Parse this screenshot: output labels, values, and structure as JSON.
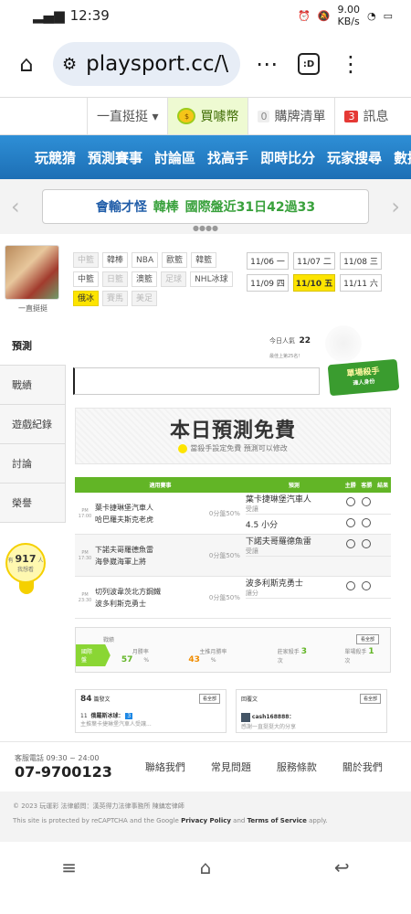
{
  "status": {
    "time": "12:39",
    "speed": "9.00",
    "speed_unit": "KB/s",
    "battery_icon": "battery-icon"
  },
  "browser": {
    "url": "playsport.cc/\\",
    "tab_icon": ":D"
  },
  "topnav": {
    "dropdown": "一直挺挺 ▾",
    "coins": "買噱幣",
    "list_count": "0",
    "list_label": "購牌清單",
    "msg_count": "3",
    "msg_label": "訊息"
  },
  "mainnav": [
    "玩競猜",
    "預測賽事",
    "討論區",
    "找高手",
    "即時比分",
    "玩家搜尋",
    "數據"
  ],
  "ticker": {
    "text": "會輸才怪",
    "team": "韓棒",
    "detail": "國際盤近31日42過33"
  },
  "profile": {
    "name": "一直挺挺"
  },
  "sidetabs": [
    "預測",
    "戰績",
    "遊戲紀錄",
    "討論",
    "榮譽"
  ],
  "bulb": {
    "pre": "有",
    "count": "917",
    "unit": "人",
    "sub": "我想看"
  },
  "filters": [
    {
      "label": "中籃",
      "state": "dim"
    },
    {
      "label": "韓棒",
      "state": "normal"
    },
    {
      "label": "NBA",
      "state": "normal"
    },
    {
      "label": "歐籃",
      "state": "normal"
    },
    {
      "label": "韓籃",
      "state": "normal"
    },
    {
      "label": "中籃",
      "state": "normal"
    },
    {
      "label": "日籃",
      "state": "dim"
    },
    {
      "label": "澳籃",
      "state": "normal"
    },
    {
      "label": "足球",
      "state": "dim"
    },
    {
      "label": "NHL冰球",
      "state": "normal"
    },
    {
      "label": "俄冰",
      "state": "sel"
    },
    {
      "label": "賽馬",
      "state": "dim"
    },
    {
      "label": "美足",
      "state": "dim"
    }
  ],
  "dates": [
    {
      "label": "11/06 一",
      "sel": false
    },
    {
      "label": "11/07 二",
      "sel": false
    },
    {
      "label": "11/08 三",
      "sel": false
    },
    {
      "label": "11/09 四",
      "sel": false
    },
    {
      "label": "11/10 五",
      "sel": true
    },
    {
      "label": "11/11 六",
      "sel": false
    }
  ],
  "today": {
    "label": "今日人氣",
    "value": "22",
    "rank": "最佳上第25名！"
  },
  "hero": {
    "title": "單場殺手",
    "sub": "達人身份"
  },
  "free": {
    "title": "本日預測免費",
    "sub": "當殺手設定免費 預測可以修改"
  },
  "table": {
    "headers": [
      "適用賽事",
      "預測",
      "主勝",
      "客勝",
      "結果"
    ],
    "rows": [
      {
        "time": "PM 17:00",
        "home": "葉卡捷琳堡汽車人",
        "away": "哈巴羅夫斯克老虎",
        "pct": "0分盤50%",
        "opt1": "葉卡捷琳堡汽車人",
        "opt1_sub": "受讓",
        "opt2": "4.5 小分",
        "shade": false
      },
      {
        "time": "PM 17:30",
        "home": "下諾夫哥羅德魚雷",
        "away": "海參崴海軍上將",
        "pct": "0分盤50%",
        "opt1": "下諾夫哥羅德魚雷",
        "opt1_sub": "受讓",
        "opt2": "",
        "shade": true
      },
      {
        "time": "PM 23:30",
        "home": "切列波韋茨北方鋼鐵",
        "away": "波多利斯克勇士",
        "pct": "0分盤50%",
        "opt1": "波多利斯克勇士",
        "opt1_sub": "讓分",
        "opt2": "",
        "shade": false
      }
    ]
  },
  "record": {
    "label": "戰績",
    "more": "看全部",
    "pill": "國際盤",
    "win_label": "月勝率",
    "win": "57",
    "home_label": "主推月勝率",
    "home": "43",
    "kill_label": "莊家殺手",
    "kill": "3",
    "single_label": "單場殺手",
    "single": "1",
    "unit": "次",
    "pct": "%"
  },
  "posts": {
    "count": "84",
    "label": "篇發文",
    "more": "看全部",
    "item_num": "11",
    "item_title": "俄羅斯冰球：",
    "item_sub": "主推葉卡捷琳堡汽車人受讓...",
    "item_badge": "3",
    "reply_label": "回覆文",
    "reply_more": "看全部",
    "reply_user": "cash168888：",
    "reply_text": "感謝一直挺挺大的分享"
  },
  "footer": {
    "phone_label": "客服電話 09:30 ~ 24:00",
    "phone": "07-9700123",
    "links": [
      "聯絡我們",
      "常見問題",
      "服務條款",
      "關於我們"
    ]
  },
  "copyright": {
    "line1": "© 2023 玩運彩 法律顧問：漢英得力法律事務所 陳鎮宏律師",
    "line2_pre": "This site is protected by reCAPTCHA and the Google ",
    "privacy": "Privacy Policy",
    "and": " and ",
    "terms": "Terms of Service",
    "apply": " apply."
  },
  "navbar": {
    "menu": "≡",
    "home": "⌂",
    "back": "↩"
  }
}
